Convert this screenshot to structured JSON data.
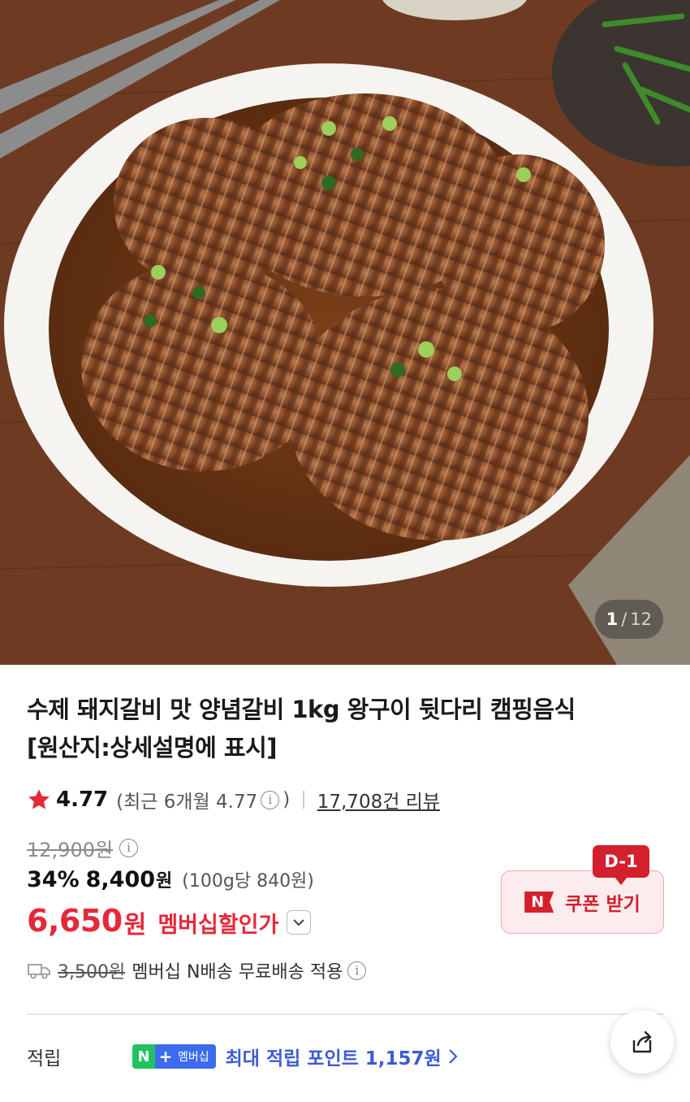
{
  "gallery": {
    "current": "1",
    "separator": "/",
    "total": "12"
  },
  "product": {
    "title_line1": "수제 돼지갈비 맛 양념갈비 1kg 왕구이 뒷다리 캠핑음식",
    "title_line2": "[원산지:상세설명에 표시]"
  },
  "rating": {
    "score": "4.77",
    "recent_prefix": "(최근 6개월 4.77",
    "recent_suffix": ")",
    "info_icon": "ⓘ",
    "reviews": "17,708건 리뷰"
  },
  "price": {
    "original": "12,900원",
    "discount_rate": "34%",
    "sale_price": "8,400",
    "won": "원",
    "unit_price": "(100g당 840원)",
    "member_price": "6,650",
    "member_won": "원",
    "member_label": "멤버십할인가"
  },
  "coupon": {
    "dday": "D-1",
    "logo": "N",
    "label": "쿠폰 받기"
  },
  "shipping": {
    "fee": "3,500원",
    "text": "멤버십 N배송 무료배송 적용"
  },
  "points": {
    "label": "적립",
    "badge_n": "N",
    "badge_plus": "+",
    "badge_text": "멤버십",
    "text": "최대 적립 포인트",
    "amount": "1,157원"
  },
  "colors": {
    "accent_red": "#e4293a",
    "coupon_red": "#d41f2c",
    "point_blue": "#3d5bd6",
    "naver_green": "#21c25e"
  },
  "icons": [
    "star-icon",
    "info-icon",
    "chevron-down-icon",
    "truck-icon",
    "chevron-right-icon",
    "share-icon"
  ]
}
